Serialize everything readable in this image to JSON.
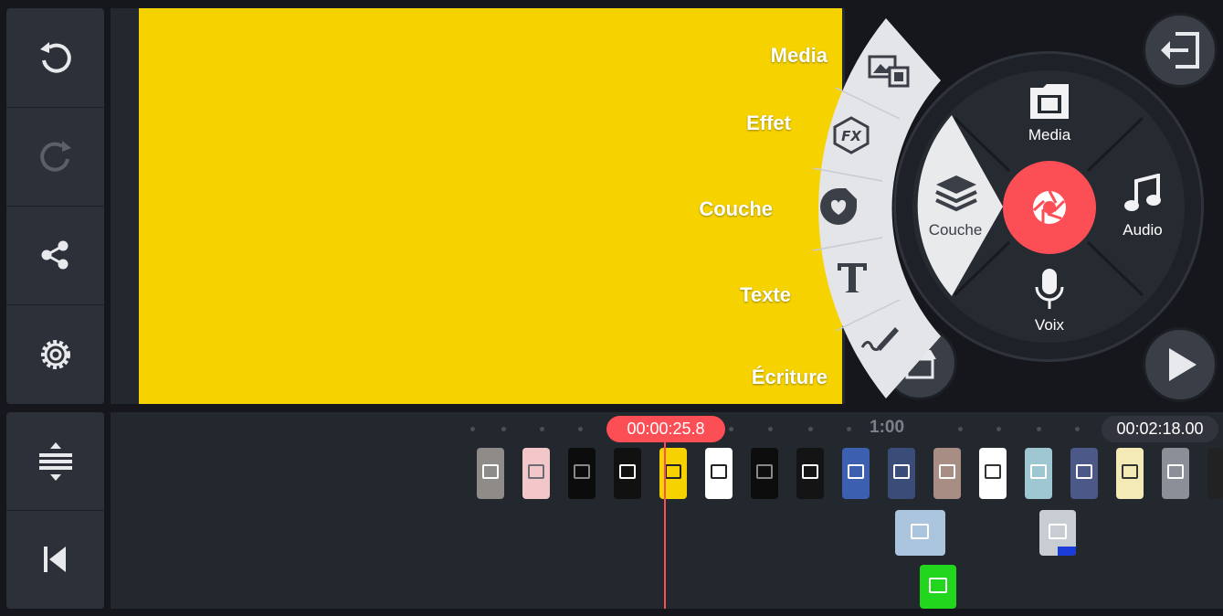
{
  "toolbar": {
    "buttons": [
      {
        "name": "undo-button",
        "icon": "undo-icon"
      },
      {
        "name": "redo-button",
        "icon": "redo-icon"
      },
      {
        "name": "share-button",
        "icon": "share-icon"
      },
      {
        "name": "settings-button",
        "icon": "gear-icon"
      },
      {
        "name": "track-height-button",
        "icon": "expand-vertical-icon"
      },
      {
        "name": "go-to-start-button",
        "icon": "skip-start-icon"
      }
    ]
  },
  "preview": {
    "background_color": "#f6d300"
  },
  "layer_menu": {
    "items": [
      {
        "label": "Media",
        "icon": "media-layer-icon"
      },
      {
        "label": "Effet",
        "icon": "fx-icon"
      },
      {
        "label": "Couche",
        "icon": "sticker-icon"
      },
      {
        "label": "Texte",
        "icon": "text-icon"
      },
      {
        "label": "Écriture",
        "icon": "handwriting-icon"
      }
    ]
  },
  "wheel": {
    "media_label": "Media",
    "layer_label": "Couche",
    "audio_label": "Audio",
    "voice_label": "Voix",
    "center_color": "#fb4e55"
  },
  "timeline": {
    "current_time": "00:00:25.8",
    "total_time": "00:02:18.00",
    "marker": "1:00"
  },
  "colors": {
    "accent": "#fb4e55",
    "background": "#15171c",
    "panel": "#2c3038"
  }
}
